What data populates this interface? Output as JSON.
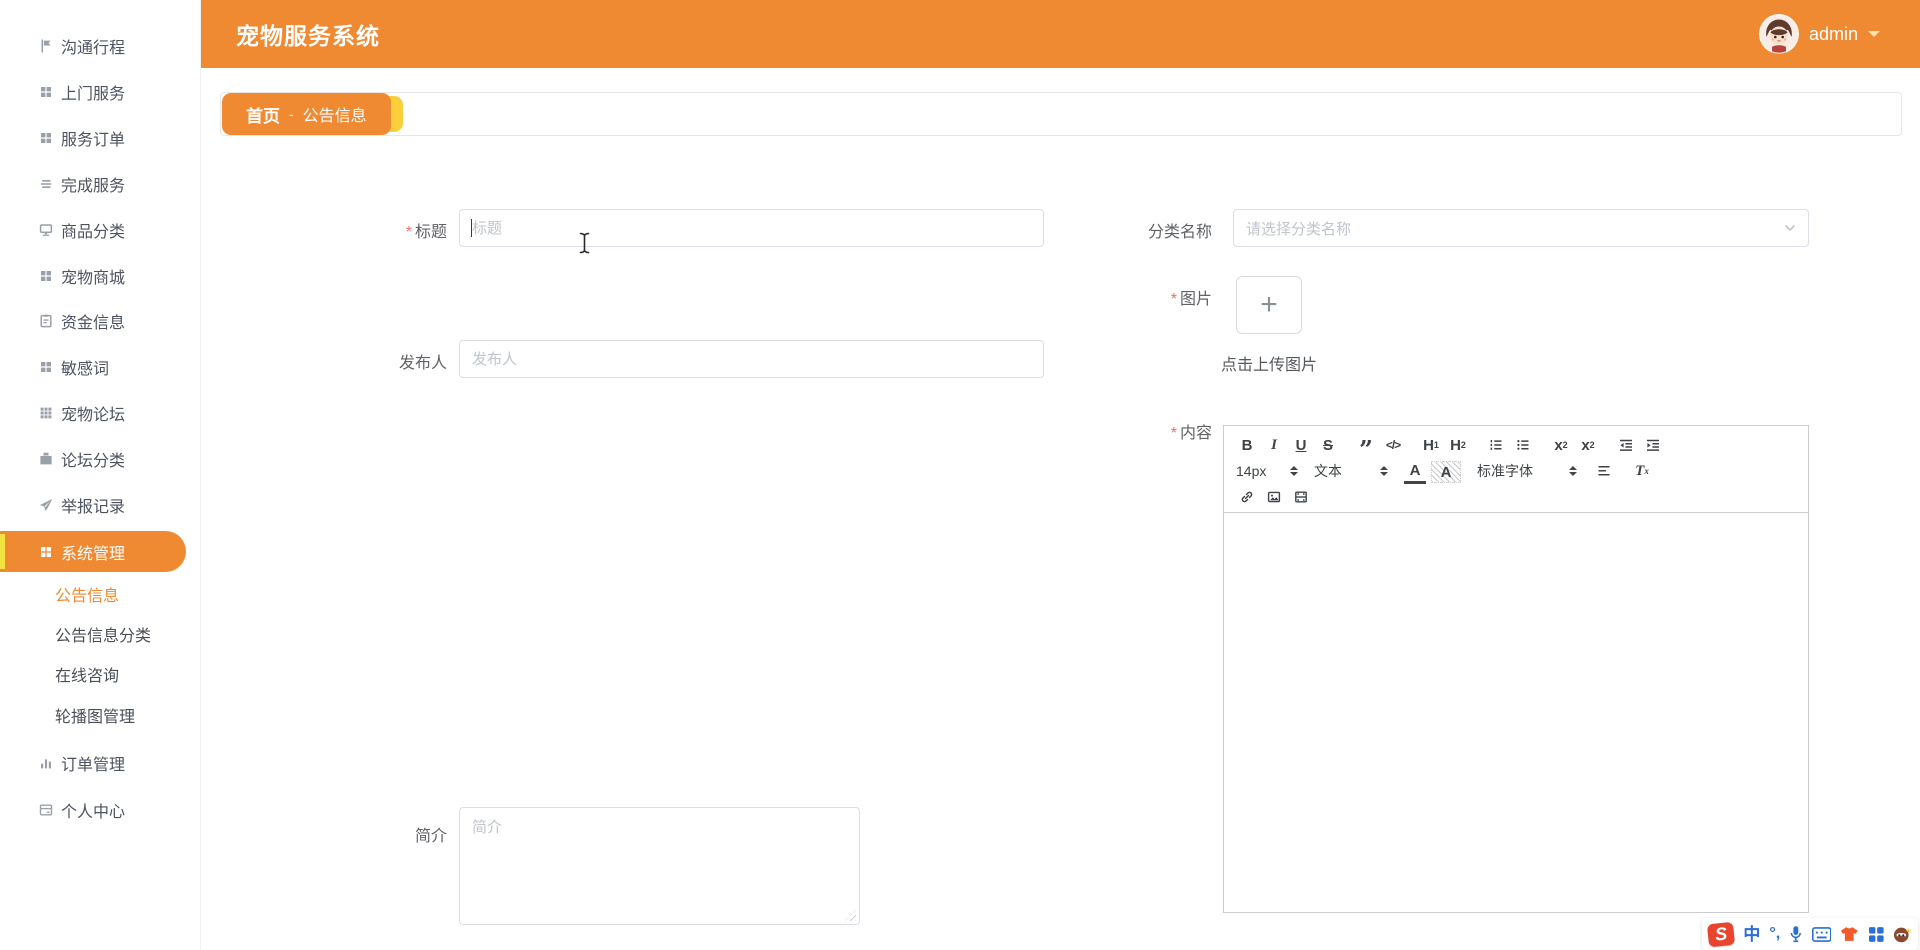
{
  "app": {
    "title": "宠物服务系统",
    "user": "admin"
  },
  "breadcrumb": {
    "home": "首页",
    "sep": "-",
    "current": "公告信息"
  },
  "sidebar": {
    "items": [
      {
        "label": "沟通行程",
        "icon": "flag-icon"
      },
      {
        "label": "上门服务",
        "icon": "grid-icon"
      },
      {
        "label": "服务订单",
        "icon": "grid-icon"
      },
      {
        "label": "完成服务",
        "icon": "list-lines-icon"
      },
      {
        "label": "商品分类",
        "icon": "monitor-icon"
      },
      {
        "label": "宠物商城",
        "icon": "grid-icon"
      },
      {
        "label": "资金信息",
        "icon": "clipboard-icon"
      },
      {
        "label": "敏感词",
        "icon": "grid-icon"
      },
      {
        "label": "宠物论坛",
        "icon": "grid9-icon"
      },
      {
        "label": "论坛分类",
        "icon": "briefcase-icon"
      },
      {
        "label": "举报记录",
        "icon": "send-icon"
      },
      {
        "label": "系统管理",
        "icon": "grid-icon",
        "active": true
      },
      {
        "label": "订单管理",
        "icon": "bar-chart-icon"
      },
      {
        "label": "个人中心",
        "icon": "card-icon"
      }
    ],
    "subitems": [
      "公告信息",
      "公告信息分类",
      "在线咨询",
      "轮播图管理"
    ],
    "active_item": "系统管理",
    "active_subitem": "公告信息"
  },
  "form": {
    "required_mark": "*",
    "title_label": "标题",
    "title_placeholder": "标题",
    "category_label": "分类名称",
    "category_placeholder": "请选择分类名称",
    "image_label": "图片",
    "upload_plus": "+",
    "upload_hint": "点击上传图片",
    "publisher_label": "发布人",
    "publisher_placeholder": "发布人",
    "content_label": "内容",
    "intro_label": "简介",
    "intro_placeholder": "简介"
  },
  "editor": {
    "bold": "B",
    "italic": "I",
    "underline": "U",
    "strike": "S",
    "quote": "”",
    "code": "</>",
    "h_base": "H",
    "h1_sub": "1",
    "h2_sub": "2",
    "x_base": "x",
    "sub_mark": "2",
    "sup_mark": "2",
    "size": "14px",
    "paragraph": "文本",
    "font": "标准字体",
    "color_letter": "A",
    "bg_letter": "A",
    "clean_base": "T",
    "clean_mark": "x"
  },
  "ime": {
    "logo_letter": "S",
    "chinese": "中",
    "punct": "°,",
    "icons": [
      "sogou-logo",
      "chinese-mode",
      "punctuation",
      "microphone-icon",
      "keyboard-icon",
      "skin-icon",
      "toolbox-icon",
      "emoji-icon"
    ]
  },
  "colors": {
    "accent": "#F08A32",
    "sidebar_active_bar": "#F2E340",
    "crumb_tag": "#FBCF3B",
    "required": "#F56C6C",
    "placeholder": "#C0C4CC",
    "input_border": "#DCDFE6"
  }
}
